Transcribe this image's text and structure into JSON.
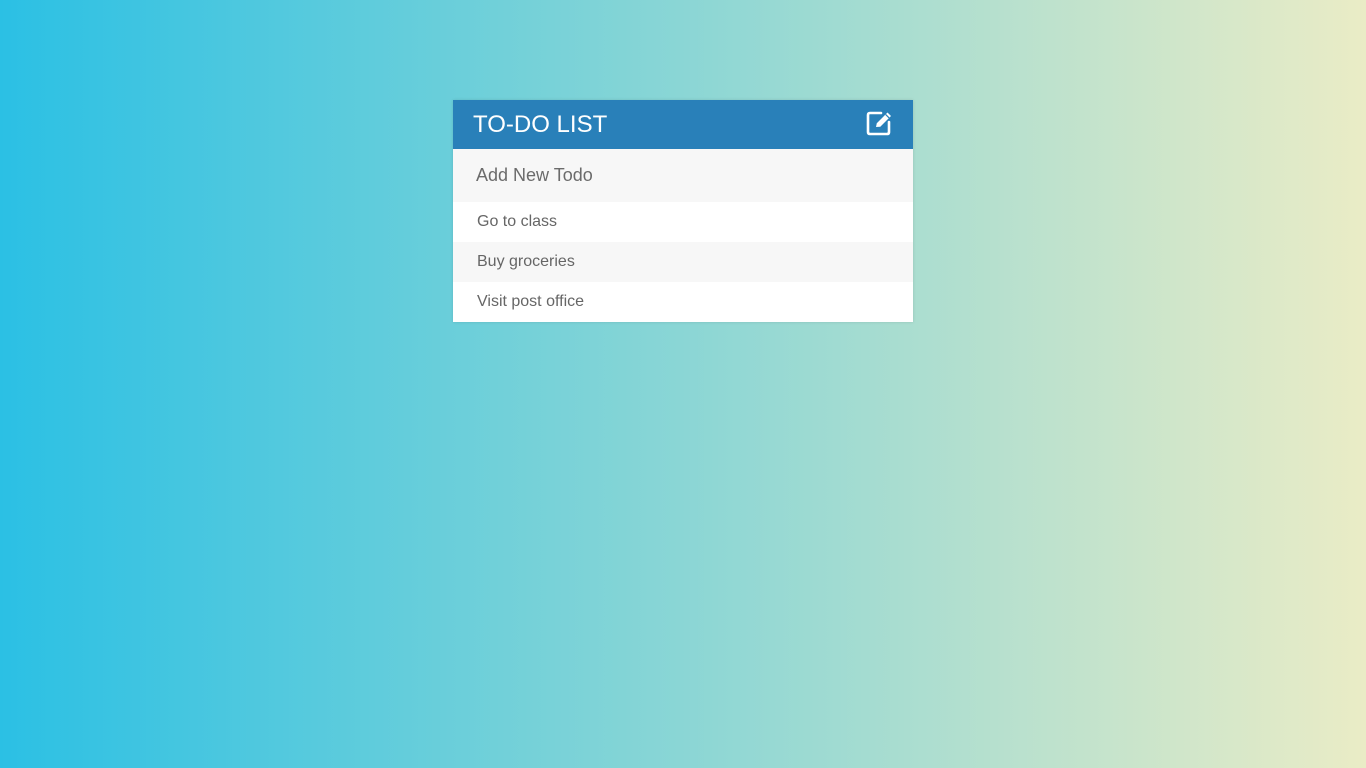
{
  "header": {
    "title": "TO-DO LIST",
    "edit_icon": "pencil-square-icon"
  },
  "new_todo": {
    "placeholder": "Add New Todo",
    "value": ""
  },
  "todos": [
    {
      "text": "Go to class"
    },
    {
      "text": "Buy groceries"
    },
    {
      "text": "Visit post office"
    }
  ],
  "colors": {
    "header_bg": "#2980b9",
    "gradient_start": "#2bc0e4",
    "gradient_end": "#eaecc6",
    "item_text": "#666666"
  }
}
